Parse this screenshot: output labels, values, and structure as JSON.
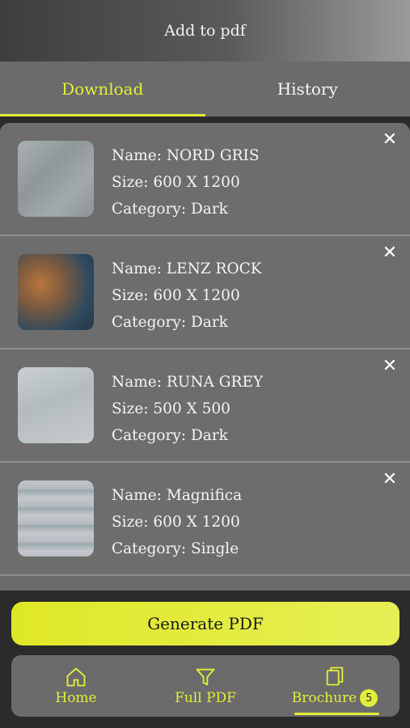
{
  "header": {
    "title": "Add to pdf"
  },
  "tabs": [
    {
      "label": "Download",
      "active": true
    },
    {
      "label": "History",
      "active": false
    }
  ],
  "items": [
    {
      "name": "Name: NORD GRIS",
      "size": "Size: 600 X 1200",
      "category": "Category: Dark",
      "thumb": "grey-marble-thumbnail"
    },
    {
      "name": "Name: LENZ ROCK",
      "size": "Size: 600 X 1200",
      "category": "Category: Dark",
      "thumb": "orange-blue-stone-thumbnail"
    },
    {
      "name": "Name: RUNA GREY",
      "size": "Size: 500 X 500",
      "category": "Category: Dark",
      "thumb": "light-grey-stone-thumbnail"
    },
    {
      "name": "Name: Magnifica",
      "size": "Size: 600 X 1200",
      "category": "Category: Single",
      "thumb": "striped-grey-thumbnail"
    }
  ],
  "close_glyph": "✕",
  "generate_button": {
    "label": "Generate PDF"
  },
  "bottom_nav": [
    {
      "label": "Home",
      "icon": "home-icon"
    },
    {
      "label": "Full PDF",
      "icon": "filter-icon"
    },
    {
      "label": "Brochure",
      "icon": "copy-icon",
      "badge": "5",
      "active": true
    }
  ],
  "colors": {
    "accent": "#e2ee3b",
    "surface": "#6b6b6b",
    "background": "#2b2b2b"
  }
}
